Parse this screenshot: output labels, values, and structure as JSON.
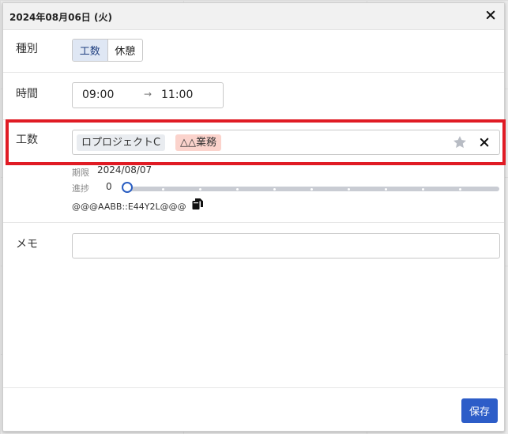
{
  "dialog": {
    "title": "2024年08月06日 (火)",
    "close_icon": "close-icon"
  },
  "form": {
    "type": {
      "label": "種別",
      "options": [
        "工数",
        "休憩"
      ],
      "selected": "工数"
    },
    "time": {
      "label": "時間",
      "start": "09:00",
      "arrow": "→",
      "end": "11:00"
    },
    "kousu": {
      "label": "工数",
      "project_tag": "ロプロジェクトC",
      "task_tag": "△△業務",
      "due_label": "期限",
      "due_value": "2024/08/07",
      "progress_label": "進捗",
      "progress_value": "0",
      "code": "@@@AABB::E44Y2L@@@",
      "icons": {
        "star": "star-icon",
        "clear": "clear-icon",
        "copy": "copy-icon"
      }
    },
    "memo": {
      "label": "メモ",
      "value": ""
    }
  },
  "footer": {
    "save_label": "保存"
  },
  "colors": {
    "accent": "#2d5dc8",
    "highlight": "#e01b24",
    "task_tag_bg": "#fbd3cc",
    "project_tag_bg": "#e9ecf0"
  }
}
